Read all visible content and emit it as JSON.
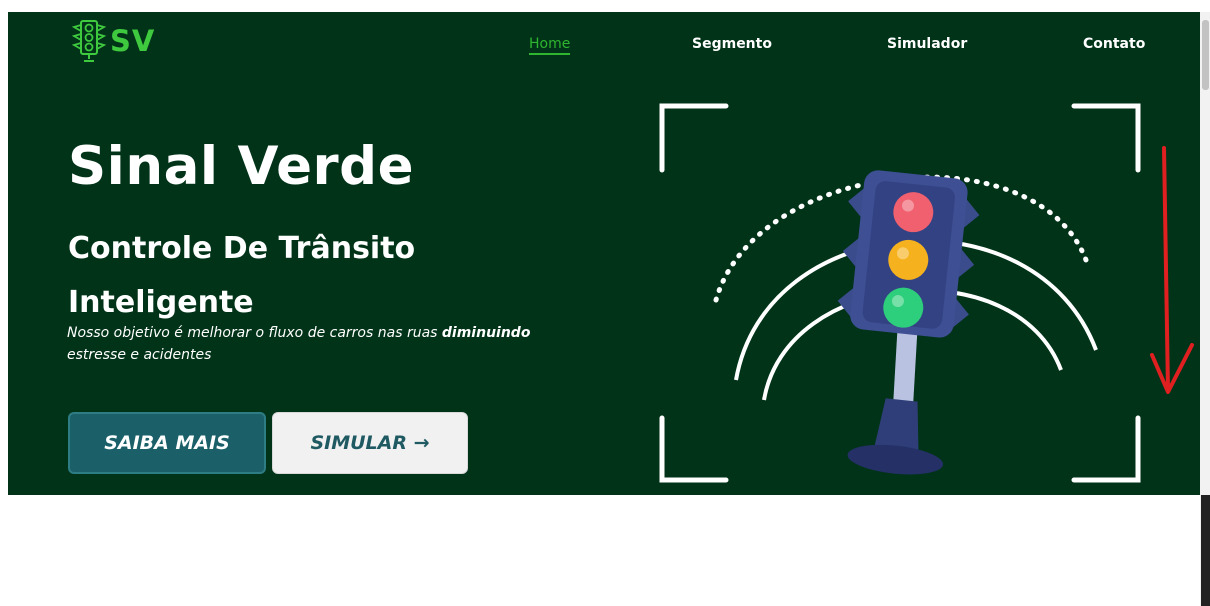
{
  "brand": {
    "logo_text": "SV",
    "logo_icon": "traffic-light-icon"
  },
  "nav": {
    "home": "Home",
    "segmento": "Segmento",
    "simulador": "Simulador",
    "contato": "Contato"
  },
  "hero": {
    "title": "Sinal Verde",
    "subtitle": "Controle De Trânsito Inteligente",
    "desc_pre": "Nosso objetivo é melhorar o fluxo de carros nas ruas ",
    "desc_bold": "diminuindo",
    "desc_post": " estresse e acidentes",
    "btn_saiba": "SAIBA MAIS",
    "btn_simular": "SIMULAR →"
  },
  "colors": {
    "hero_bg": "#003318",
    "accent": "#2fb52f",
    "primary_button": "#1b6069",
    "annotation": "#e02020"
  },
  "icons": [
    "traffic-light-icon",
    "arrow-right-icon",
    "scroll-down-arrow-icon"
  ]
}
